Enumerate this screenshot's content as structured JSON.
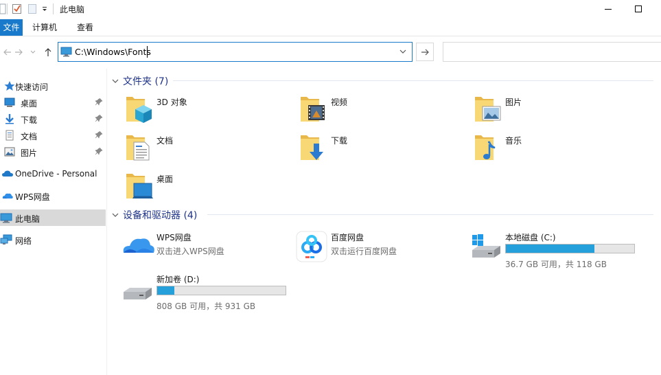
{
  "titlebar": {
    "title": "此电脑",
    "minimize_icon": "minimize-icon",
    "maximize_icon": "maximize-icon"
  },
  "ribbon": {
    "tabs": [
      {
        "label": "文件",
        "active": true
      },
      {
        "label": "计算机"
      },
      {
        "label": "查看"
      }
    ],
    "accent": "#1979ca"
  },
  "navigation": {
    "address": "C:\\Windows\\Fonts",
    "search_placeholder": ""
  },
  "sidebar": {
    "items": [
      {
        "label": "快速访问",
        "icon": "star-icon"
      },
      {
        "label": "桌面",
        "icon": "desktop-icon",
        "pinned": true
      },
      {
        "label": "下载",
        "icon": "download-icon",
        "pinned": true
      },
      {
        "label": "文档",
        "icon": "document-icon",
        "pinned": true
      },
      {
        "label": "图片",
        "icon": "picture-icon",
        "pinned": true
      },
      {
        "label": "OneDrive - Personal",
        "icon": "cloud-icon"
      },
      {
        "label": "WPS网盘",
        "icon": "wps-cloud-icon"
      },
      {
        "label": "此电脑",
        "icon": "computer-icon",
        "selected": true
      },
      {
        "label": "网络",
        "icon": "network-icon"
      }
    ]
  },
  "folders_group": {
    "title": "文件夹 (7)",
    "items": [
      {
        "name": "3D 对象",
        "icon": "3d-objects-folder-icon"
      },
      {
        "name": "视频",
        "icon": "videos-folder-icon"
      },
      {
        "name": "图片",
        "icon": "pictures-folder-icon"
      },
      {
        "name": "文档",
        "icon": "documents-folder-icon"
      },
      {
        "name": "下载",
        "icon": "downloads-folder-icon"
      },
      {
        "name": "音乐",
        "icon": "music-folder-icon"
      },
      {
        "name": "桌面",
        "icon": "desktop-folder-icon"
      }
    ]
  },
  "devices_group": {
    "title": "设备和驱动器 (4)",
    "items": [
      {
        "name": "WPS网盘",
        "subtitle": "双击进入WPS网盘",
        "icon": "wps-cloud-icon"
      },
      {
        "name": "百度网盘",
        "subtitle": "双击运行百度网盘",
        "icon": "baidu-netdisk-icon"
      },
      {
        "name": "本地磁盘 (C:)",
        "usage_text": "36.7 GB 可用，共 118 GB",
        "used_fraction": 0.689,
        "icon": "windows-drive-icon"
      },
      {
        "name": "新加卷 (D:)",
        "usage_text": "808 GB 可用，共 931 GB",
        "used_fraction": 0.132,
        "icon": "drive-icon"
      }
    ],
    "bar_color": "#26a0da"
  }
}
